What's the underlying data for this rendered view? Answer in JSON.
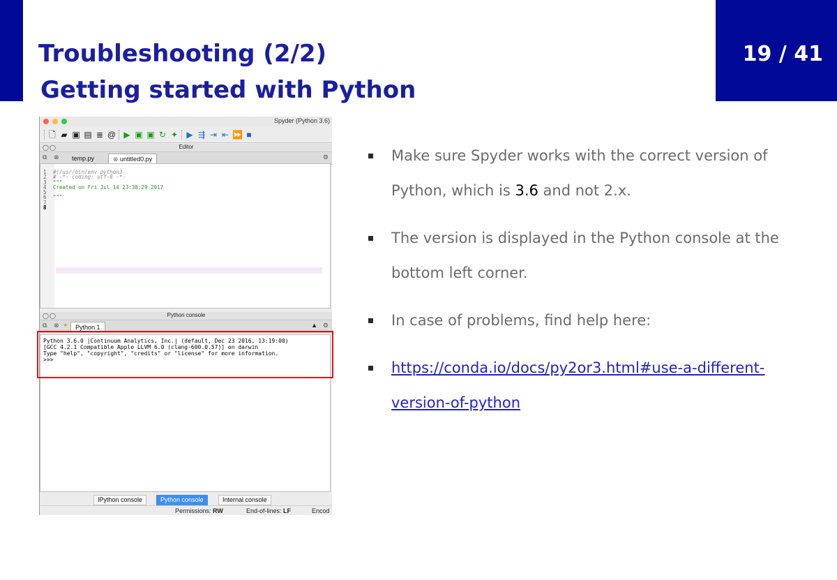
{
  "slide": {
    "title": "Troubleshooting (2/2)",
    "subtitle": "Getting started with Python",
    "page": "19 / 41"
  },
  "spyder": {
    "window_title": "Spyder (Python 3.6)",
    "editor": {
      "pane_title": "Editor",
      "tabs": [
        "temp.py",
        "untitled0.py"
      ],
      "active_tab": "untitled0.py",
      "lines": [
        {
          "n": "1",
          "text": "#!/usr/bin/env python3"
        },
        {
          "n": "2",
          "text": "# -*- coding: utf-8 -*-"
        },
        {
          "n": "3",
          "text": "\"\"\""
        },
        {
          "n": "4",
          "text": "Created on Fri Jul 14 23:38:29 2017"
        },
        {
          "n": "5",
          "text": ""
        },
        {
          "n": "6",
          "text": "\"\"\""
        },
        {
          "n": "7",
          "text": ""
        },
        {
          "n": "8",
          "text": ""
        }
      ]
    },
    "console": {
      "pane_title": "Python console",
      "tab": "Python 1",
      "output": [
        "Python 3.6.0 |Continuum Analytics, Inc.| (default, Dec 23 2016, 13:19:00)",
        "[GCC 4.2.1 Compatible Apple LLVM 6.0 (clang-600.0.57)] on darwin",
        "Type \"help\", \"copyright\", \"credits\" or \"license\" for more information.",
        ">>>"
      ]
    },
    "bottom_tabs": [
      "IPython console",
      "Python console",
      "Internal console"
    ],
    "active_bottom_tab": "Python console",
    "status": {
      "permissions_label": "Permissions:",
      "permissions_value": "RW",
      "eol_label": "End-of-lines:",
      "eol_value": "LF",
      "encoding_label": "Encod"
    },
    "colors": {
      "highlight_box": "#e0151b",
      "active_tab": "#3d8ef0"
    }
  },
  "bullets": {
    "b1_pre": "Make sure Spyder works with the correct version of Python, which is ",
    "b1_version": "3.6",
    "b1_post": " and not 2.x.",
    "b2": "The version is displayed in the Python console at the bottom left corner.",
    "b3": "In case of problems, find help here:",
    "b4_link": "https://conda.io/docs/py2or3.html#use-a-different-version-of-python"
  },
  "theme": {
    "brand_blue": "#000a96",
    "title_blue": "#1a1fa0"
  }
}
